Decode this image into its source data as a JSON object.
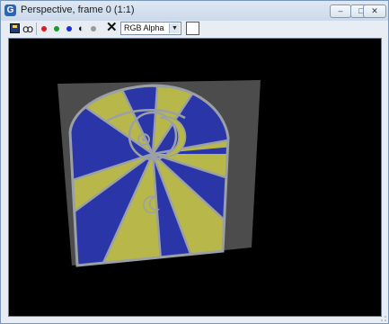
{
  "window": {
    "title": "Perspective, frame 0 (1:1)",
    "app_icon_letter": "G",
    "controls": {
      "minimize": "–",
      "maximize": "□",
      "close": "✕"
    }
  },
  "toolbar": {
    "clone_glyph": "ꝏ",
    "mono_glyph": "◐",
    "clear_glyph": "✕",
    "channels": [
      {
        "name": "red",
        "color": "#e21a1a"
      },
      {
        "name": "green",
        "color": "#1a9a2a"
      },
      {
        "name": "blue",
        "color": "#1a2fd8"
      }
    ],
    "channel_select": {
      "value": "RGB Alpha"
    },
    "swatch_color": "#ffffff"
  },
  "colors": {
    "glass_yellow": "#b8b84a",
    "glass_blue": "#2a36a8",
    "lead": "#9aa0a6",
    "backing": "#4c4c4c",
    "background": "#000000"
  }
}
